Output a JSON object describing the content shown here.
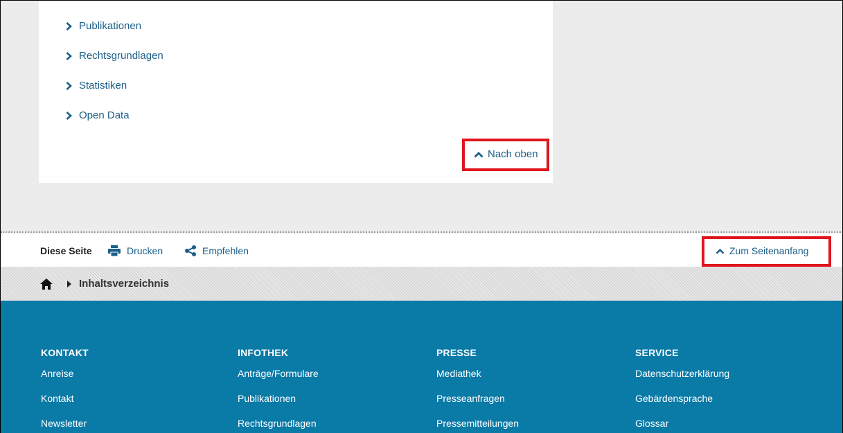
{
  "sidebar_links": [
    "Publikationen",
    "Rechtsgrundlagen",
    "Statistiken",
    "Open Data"
  ],
  "nach_oben": "Nach oben",
  "this_page": {
    "label": "Diese Seite",
    "print": "Drucken",
    "recommend": "Empfehlen",
    "to_top": "Zum Seitenanfang"
  },
  "breadcrumb": {
    "current": "Inhaltsverzeichnis"
  },
  "footer": {
    "columns": [
      {
        "title": "KONTAKT",
        "links": [
          "Anreise",
          "Kontakt",
          "Newsletter"
        ]
      },
      {
        "title": "INFOTHEK",
        "links": [
          "Anträge/Formulare",
          "Publikationen",
          "Rechtsgrundlagen"
        ]
      },
      {
        "title": "PRESSE",
        "links": [
          "Mediathek",
          "Presseanfragen",
          "Pressemitteilungen"
        ]
      },
      {
        "title": "SERVICE",
        "links": [
          "Datenschutzerklärung",
          "Gebärdensprache",
          "Glossar"
        ]
      }
    ]
  },
  "colors": {
    "link": "#1b5f88",
    "footer_bg": "#0a7aa7",
    "highlight": "#e0151c"
  },
  "icons": [
    "chevron-right-icon",
    "chevron-up-icon",
    "printer-icon",
    "share-icon",
    "home-icon",
    "triangle-right-icon"
  ]
}
